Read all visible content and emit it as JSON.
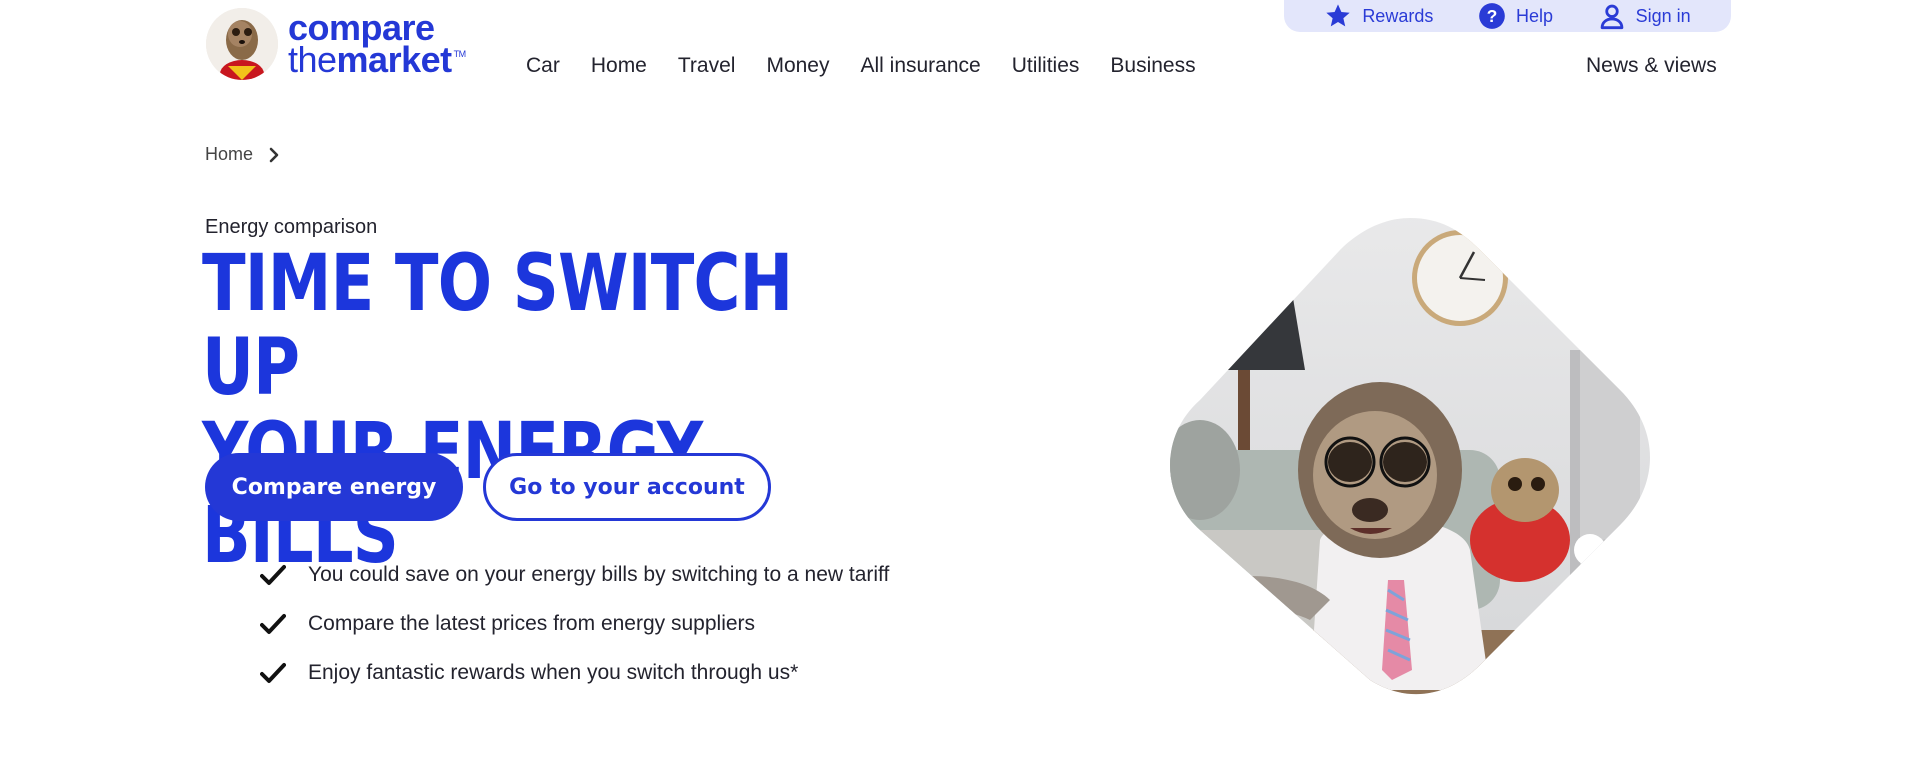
{
  "brand": {
    "logo_line1": "compare",
    "logo_line2_a": "the",
    "logo_line2_b": "market",
    "trademark": "TM",
    "primary_color": "#2438d6",
    "headline_color": "#1c36dc"
  },
  "utility_nav": [
    {
      "label": "Rewards",
      "icon": "star-icon"
    },
    {
      "label": "Help",
      "icon": "help-icon"
    },
    {
      "label": "Sign in",
      "icon": "user-icon"
    }
  ],
  "main_nav": [
    "Car",
    "Home",
    "Travel",
    "Money",
    "All insurance",
    "Utilities",
    "Business"
  ],
  "news_link": "News & views",
  "breadcrumb": {
    "home": "Home",
    "separator_icon": "chevron-right-icon"
  },
  "hero": {
    "eyebrow": "Energy comparison",
    "headline_line1": "TIME TO SWITCH UP",
    "headline_line2": "YOUR ENERGY BILLS",
    "primary_cta": "Compare energy",
    "secondary_cta": "Go to your account",
    "benefits": [
      "You could save on your energy bills by switching to a new tariff",
      "Compare the latest prices from energy suppliers",
      "Enjoy fantastic rewards when you switch through us*"
    ]
  }
}
